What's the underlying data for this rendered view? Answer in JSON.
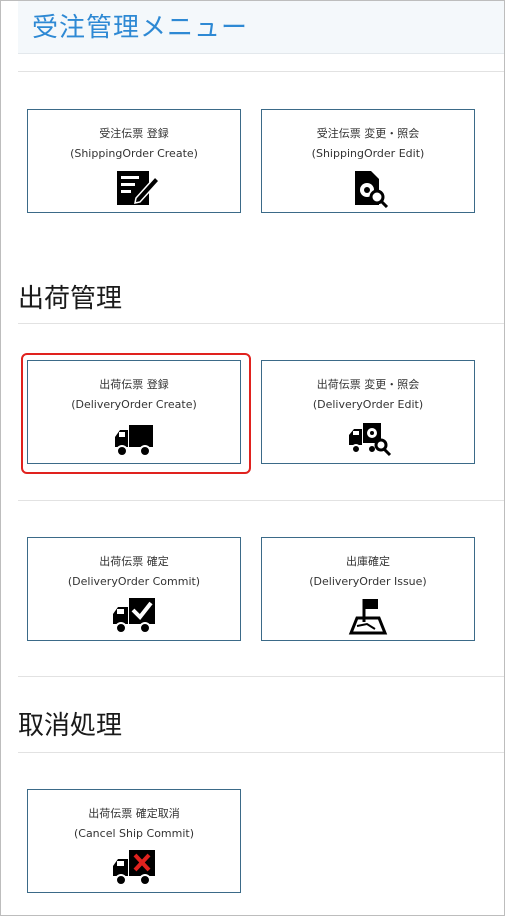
{
  "header": {
    "title": "受注管理メニュー"
  },
  "sections": {
    "shipping_mgmt": "出荷管理",
    "cancel": "取消処理"
  },
  "tiles": {
    "so_create": {
      "line1": "受注伝票 登録",
      "line2": "(ShippingOrder Create)",
      "icon": "edit-form-icon"
    },
    "so_edit": {
      "line1": "受注伝票 変更・照会",
      "line2": "(ShippingOrder Edit)",
      "icon": "document-search-icon"
    },
    "do_create": {
      "line1": "出荷伝票 登録",
      "line2": "(DeliveryOrder Create)",
      "icon": "truck-icon"
    },
    "do_edit": {
      "line1": "出荷伝票 変更・照会",
      "line2": "(DeliveryOrder Edit)",
      "icon": "truck-search-icon"
    },
    "do_commit": {
      "line1": "出荷伝票 確定",
      "line2": "(DeliveryOrder Commit)",
      "icon": "truck-check-icon"
    },
    "do_issue": {
      "line1": "出庫確定",
      "line2": "(DeliveryOrder Issue)",
      "icon": "map-flag-icon"
    },
    "cancel_commit": {
      "line1": "出荷伝票 確定取消",
      "line2": "(Cancel Ship Commit)",
      "icon": "truck-cancel-icon"
    }
  },
  "colors": {
    "accent": "#2e89d4",
    "selection": "#e0221e",
    "tile_border": "#3b6a88",
    "cancel_mark": "#e0221e"
  }
}
